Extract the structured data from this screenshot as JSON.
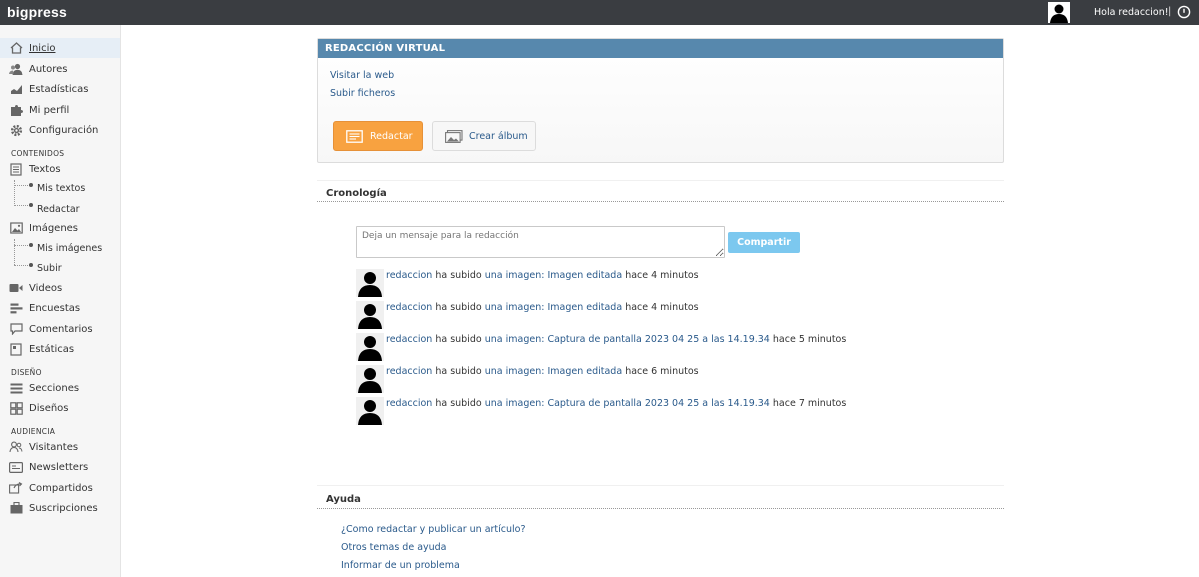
{
  "topbar": {
    "brand": "bigpress",
    "greeting": "Hola redaccion!",
    "separator": "|"
  },
  "sidebar": {
    "items": [
      {
        "label": "Inicio",
        "icon": "home-icon"
      },
      {
        "label": "Autores",
        "icon": "users-icon"
      },
      {
        "label": "Estadísticas",
        "icon": "chart-icon"
      },
      {
        "label": "Mi perfil",
        "icon": "puzzle-icon"
      },
      {
        "label": "Configuración",
        "icon": "gear-icon"
      }
    ],
    "section_contenidos": "CONTENIDOS",
    "textos": {
      "label": "Textos",
      "icon": "document-icon",
      "sub": [
        "Mis textos",
        "Redactar"
      ]
    },
    "imagenes": {
      "label": "Imágenes",
      "icon": "image-icon",
      "sub": [
        "Mis imágenes",
        "Subir"
      ]
    },
    "contenidos_items": [
      {
        "label": "Videos",
        "icon": "video-icon"
      },
      {
        "label": "Encuestas",
        "icon": "poll-icon"
      },
      {
        "label": "Comentarios",
        "icon": "comment-icon"
      },
      {
        "label": "Estáticas",
        "icon": "page-icon"
      }
    ],
    "section_diseno": "DISEÑO",
    "diseno_items": [
      {
        "label": "Secciones",
        "icon": "sections-icon"
      },
      {
        "label": "Diseños",
        "icon": "grid-icon"
      }
    ],
    "section_audiencia": "AUDIENCIA",
    "audiencia_items": [
      {
        "label": "Visitantes",
        "icon": "visitors-icon"
      },
      {
        "label": "Newsletters",
        "icon": "newsletter-icon"
      },
      {
        "label": "Compartidos",
        "icon": "share-icon"
      },
      {
        "label": "Suscripciones",
        "icon": "subscription-icon"
      }
    ]
  },
  "virtual": {
    "title": "REDACCIÓN VIRTUAL",
    "link_web": "Visitar la web",
    "link_upload": "Subir ficheros",
    "btn_write": "Redactar",
    "btn_album": "Crear álbum"
  },
  "timeline": {
    "title": "Cronología",
    "placeholder": "Deja un mensaje para la redacción",
    "share": "Compartir",
    "entries": [
      {
        "user": "redaccion",
        "action": "ha subido",
        "object": "una imagen: Imagen editada",
        "time": "hace 4 minutos"
      },
      {
        "user": "redaccion",
        "action": "ha subido",
        "object": "una imagen: Imagen editada",
        "time": "hace 4 minutos"
      },
      {
        "user": "redaccion",
        "action": "ha subido",
        "object": "una imagen: Captura de pantalla 2023 04 25 a las 14.19.34",
        "time": "hace 5 minutos"
      },
      {
        "user": "redaccion",
        "action": "ha subido",
        "object": "una imagen: Imagen editada",
        "time": "hace 6 minutos"
      },
      {
        "user": "redaccion",
        "action": "ha subido",
        "object": "una imagen: Captura de pantalla 2023 04 25 a las 14.19.34",
        "time": "hace 7 minutos"
      }
    ]
  },
  "help": {
    "title": "Ayuda",
    "links": [
      "¿Como redactar y publicar un artículo?",
      "Otros temas de ayuda",
      "Informar de un problema"
    ]
  },
  "colors": {
    "topbar": "#3a3d41",
    "panel_header": "#5788ad",
    "primary_button": "#f8a240",
    "share_button": "#7cc8ef",
    "link": "#2a5a8b"
  }
}
